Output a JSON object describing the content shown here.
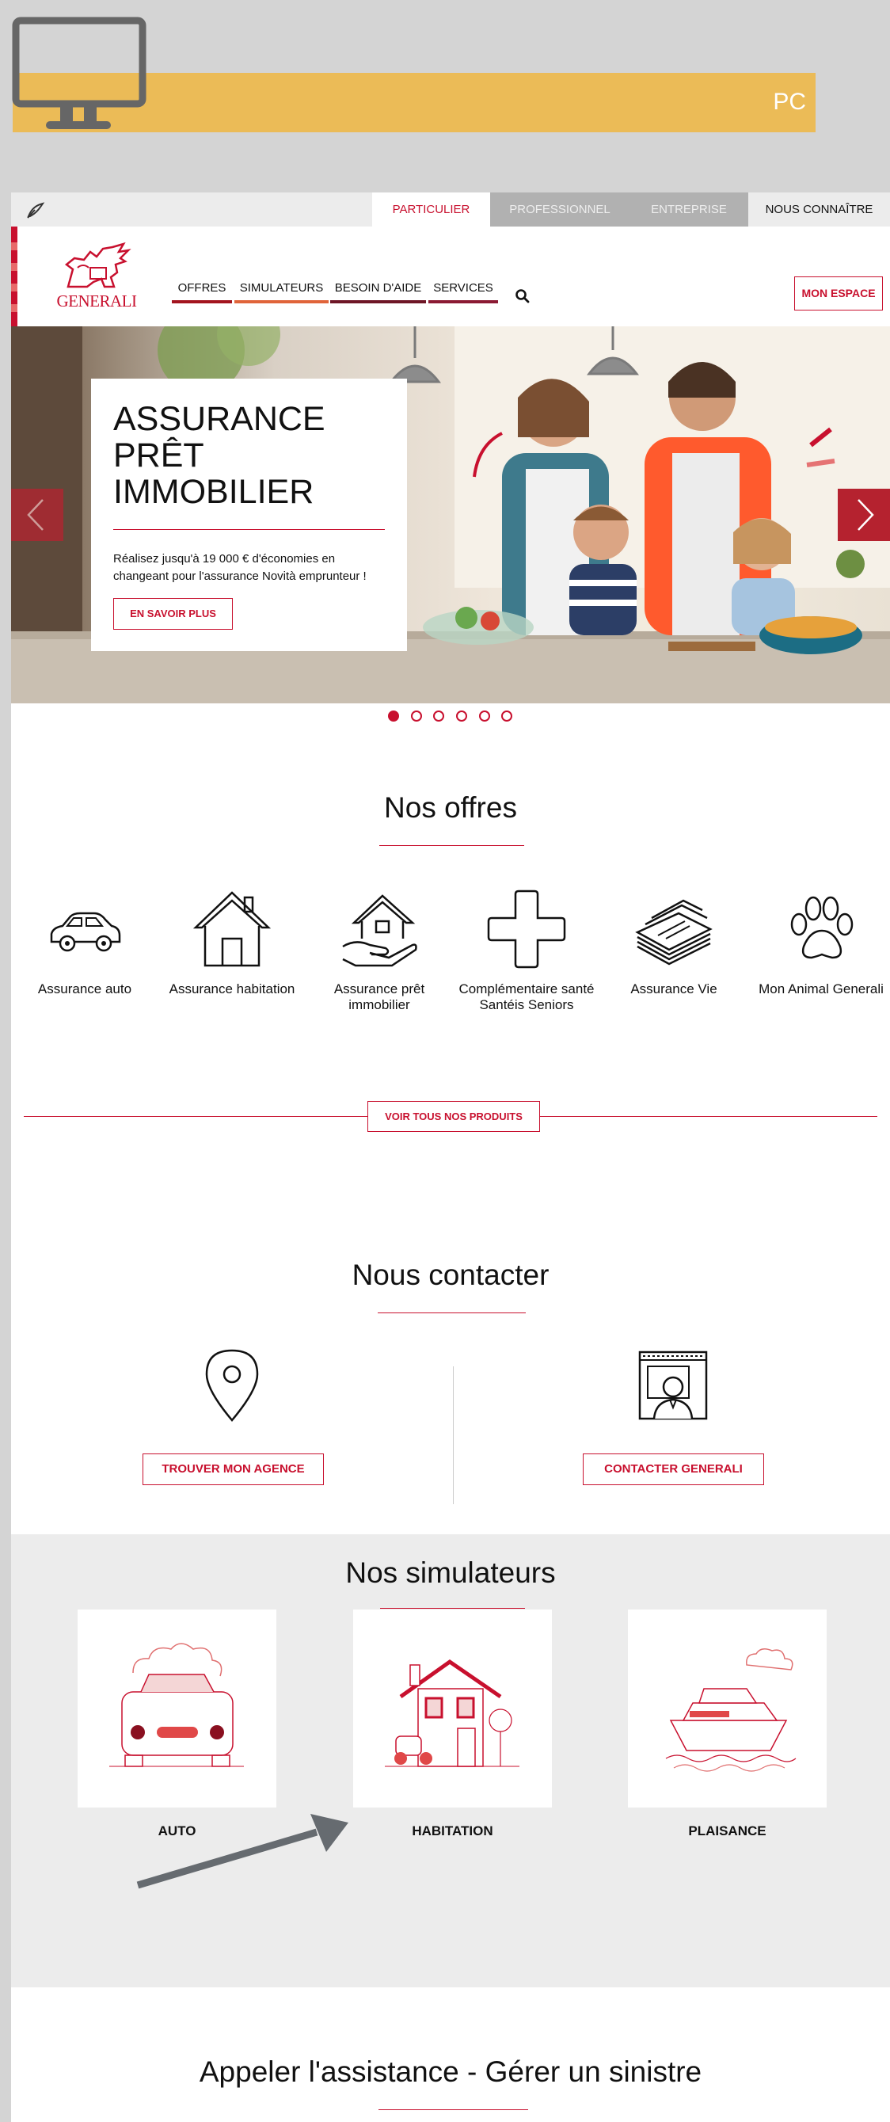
{
  "banner": {
    "label": "PC"
  },
  "topbar": {
    "tabs": [
      {
        "label": "PARTICULIER"
      },
      {
        "label": "PROFESSIONNEL"
      },
      {
        "label": "ENTREPRISE"
      },
      {
        "label": "NOUS CONNAÎTRE"
      }
    ]
  },
  "header": {
    "logo_text": "GENERALI",
    "nav": [
      {
        "label": "OFFRES",
        "color": "#a3141f"
      },
      {
        "label": "SIMULATEURS",
        "color": "#e0643a"
      },
      {
        "label": "BESOIN D'AIDE",
        "color": "#6e1626"
      },
      {
        "label": "SERVICES",
        "color": "#8b1a33"
      }
    ],
    "account_label": "MON ESPACE"
  },
  "hero": {
    "title_lines": [
      "ASSURANCE",
      "PRÊT",
      "IMMOBILIER"
    ],
    "description": "Réalisez jusqu'à 19 000 € d'économies en changeant pour l'assurance Novità emprunteur !",
    "cta": "EN SAVOIR PLUS",
    "slides": 6,
    "active_slide": 1
  },
  "offers": {
    "title": "Nos offres",
    "items": [
      {
        "label": "Assurance auto",
        "icon": "car-icon"
      },
      {
        "label": "Assurance habitation",
        "icon": "house-icon"
      },
      {
        "label": "Assurance prêt immobilier",
        "icon": "hand-house-icon"
      },
      {
        "label": "Complémentaire santé Santéis Seniors",
        "icon": "health-cross-icon"
      },
      {
        "label": "Assurance Vie",
        "icon": "money-stack-icon"
      },
      {
        "label": "Mon Animal Generali",
        "icon": "paw-icon"
      }
    ],
    "all_products_label": "VOIR TOUS NOS PRODUITS"
  },
  "contact": {
    "title": "Nous contacter",
    "find_agency_label": "TROUVER MON AGENCE",
    "contact_label": "CONTACTER GENERALI"
  },
  "simulators": {
    "title": "Nos simulateurs",
    "items": [
      {
        "label": "AUTO",
        "icon": "car-sim-icon"
      },
      {
        "label": "HABITATION",
        "icon": "house-sim-icon"
      },
      {
        "label": "PLAISANCE",
        "icon": "boat-sim-icon"
      }
    ]
  },
  "assistance": {
    "title": "Appeler l'assistance - Gérer un sinistre"
  },
  "colors": {
    "brand_red": "#c8102e",
    "banner_yellow": "#ebbb57"
  }
}
